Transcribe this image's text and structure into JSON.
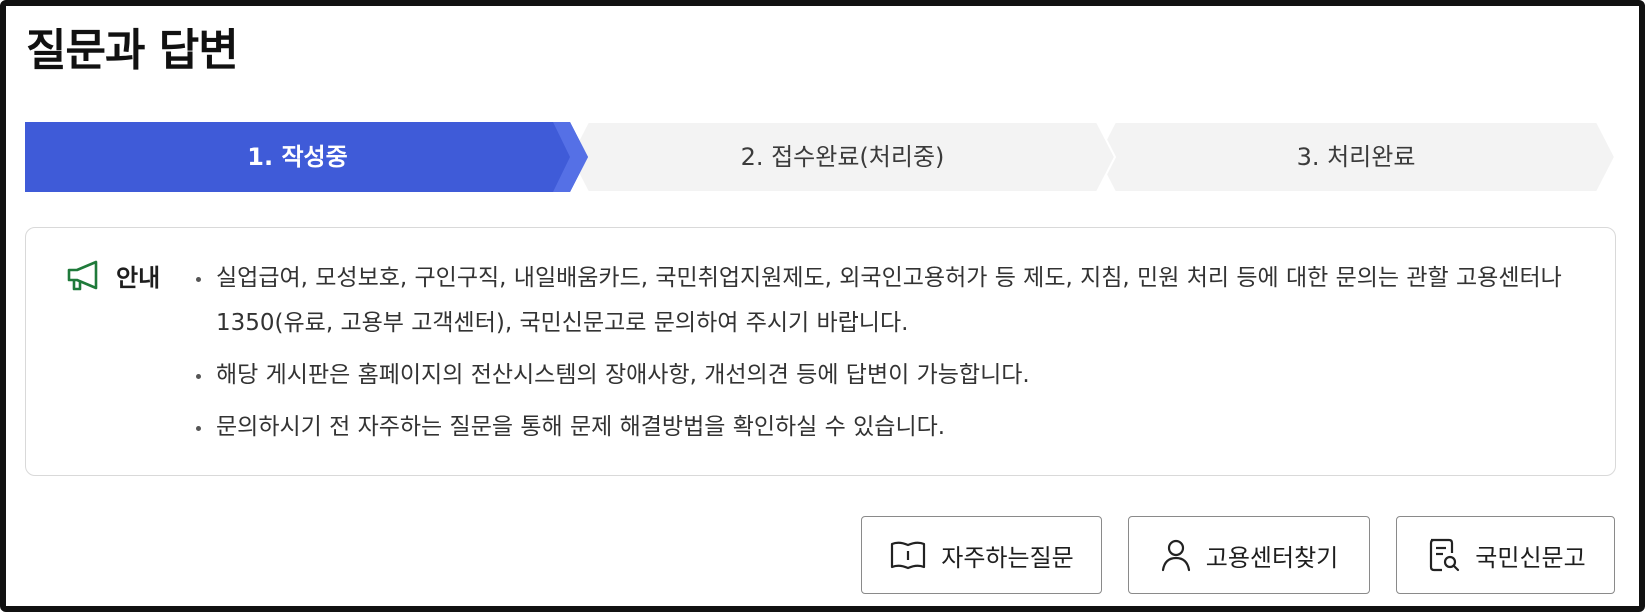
{
  "page": {
    "title": "질문과 답변"
  },
  "steps": [
    {
      "label": "1. 작성중",
      "active": true
    },
    {
      "label": "2. 접수완료(처리중)",
      "active": false
    },
    {
      "label": "3. 처리완료",
      "active": false
    }
  ],
  "notice": {
    "label": "안내",
    "items": [
      "실업급여, 모성보호, 구인구직, 내일배움카드, 국민취업지원제도, 외국인고용허가 등 제도, 지침, 민원 처리 등에 대한 문의는 관할 고용센터나 1350(유료, 고용부 고객센터), 국민신문고로 문의하여 주시기 바랍니다.",
      "해당 게시판은 홈페이지의 전산시스템의 장애사항, 개선의견 등에 답변이 가능합니다.",
      "문의하시기 전 자주하는 질문을 통해 문제 해결방법을 확인하실 수 있습니다."
    ]
  },
  "buttons": {
    "faq": "자주하는질문",
    "center": "고용센터찾기",
    "petition": "국민신문고"
  },
  "colors": {
    "active_step": "#3f5bd8",
    "inactive_step": "#f3f3f3",
    "notice_icon": "#1f7a3a"
  },
  "icons": {
    "notice": "megaphone-icon",
    "faq": "book-icon",
    "center": "person-icon",
    "petition": "document-search-icon"
  }
}
